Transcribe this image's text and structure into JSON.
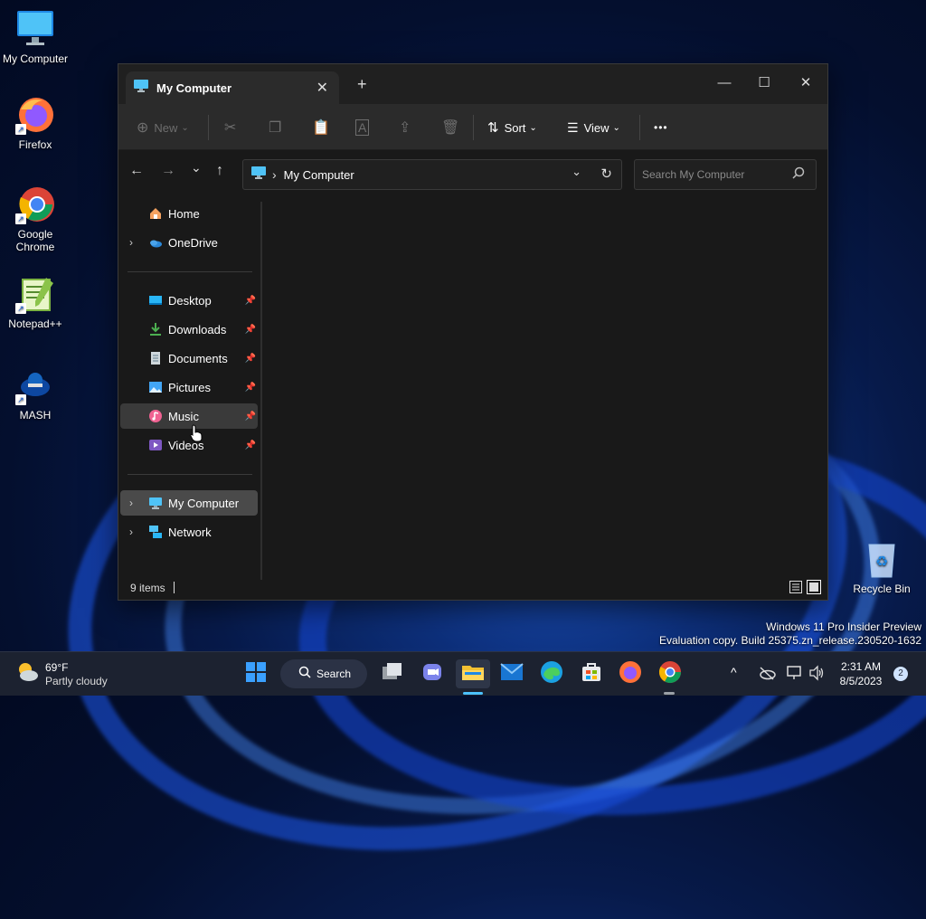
{
  "desktop": {
    "icons": [
      {
        "label": "My Computer"
      },
      {
        "label": "Firefox"
      },
      {
        "label": "Google Chrome"
      },
      {
        "label": "Notepad++"
      },
      {
        "label": "MASH"
      },
      {
        "label": "Recycle Bin"
      }
    ],
    "shortcut_arrow": "↗"
  },
  "explorer": {
    "tab": {
      "title": "My Computer",
      "close": "✕"
    },
    "new_tab": "+",
    "window_controls": {
      "minimize": "—",
      "maximize": "☐",
      "close": "✕"
    },
    "toolbar": {
      "new_label": "New",
      "sort_label": "Sort",
      "view_label": "View",
      "more": "•••"
    },
    "address": {
      "path_sep": "›",
      "current": "My Computer",
      "search_placeholder": "Search My Computer"
    },
    "nav_glyphs": {
      "back": "←",
      "forward": "→",
      "recent": "⌄",
      "up": "↑",
      "dropdown": "⌄",
      "refresh": "↻"
    },
    "sidebar": {
      "top": [
        {
          "label": "Home"
        },
        {
          "label": "OneDrive",
          "expandable": true
        }
      ],
      "pinned": [
        {
          "label": "Desktop"
        },
        {
          "label": "Downloads"
        },
        {
          "label": "Documents"
        },
        {
          "label": "Pictures"
        },
        {
          "label": "Music",
          "state": "hover"
        },
        {
          "label": "Videos"
        }
      ],
      "devices": [
        {
          "label": "My Computer",
          "expandable": true,
          "state": "selected"
        },
        {
          "label": "Network",
          "expandable": true
        }
      ],
      "chevron": "›",
      "pin_glyph": "📌"
    },
    "status": {
      "items_count": "9 items"
    }
  },
  "watermark": {
    "line1": "Windows 11 Pro Insider Preview",
    "line2": "Evaluation copy. Build 25375.zn_release.230520-1632"
  },
  "taskbar": {
    "weather": {
      "temp": "69°F",
      "condition": "Partly cloudy"
    },
    "search_label": "Search",
    "clock": {
      "time": "2:31 AM",
      "date": "8/5/2023"
    },
    "notification_count": "2",
    "tray_chevron": "^"
  },
  "colors": {
    "accent": "#4cc2ff",
    "folder_yellow": "#f3c132"
  }
}
